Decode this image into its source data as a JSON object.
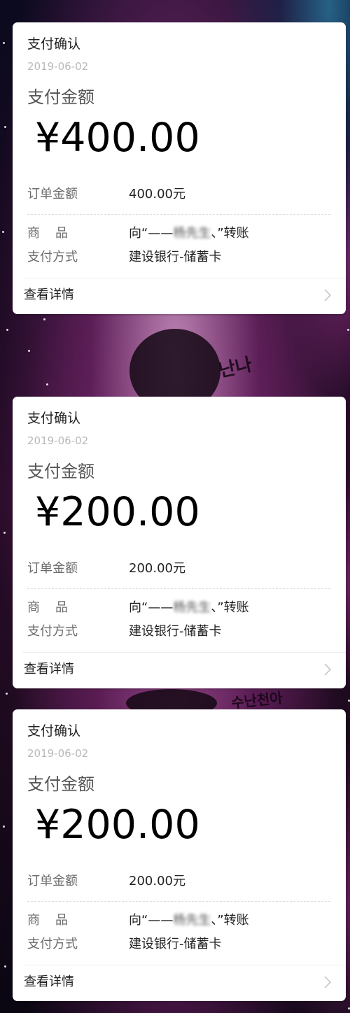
{
  "cards": [
    {
      "title": "支付确认",
      "date": "2019-06-02",
      "amount_label": "支付金额",
      "amount": "¥400.00",
      "order_label": "订单金额",
      "order_value": "400.00元",
      "goods_label": "商品",
      "goods_prefix": "向“——",
      "goods_name": "杨先生",
      "goods_suffix": "、”转账",
      "method_label": "支付方式",
      "method_value": "建设银行-储蓄卡",
      "details_label": "查看详情"
    },
    {
      "title": "支付确认",
      "date": "2019-06-02",
      "amount_label": "支付金额",
      "amount": "¥200.00",
      "order_label": "订单金额",
      "order_value": "200.00元",
      "goods_label": "商品",
      "goods_prefix": "向“——",
      "goods_name": "杨先生",
      "goods_suffix": "、”转账",
      "method_label": "支付方式",
      "method_value": "建设银行-储蓄卡",
      "details_label": "查看详情"
    },
    {
      "title": "支付确认",
      "date": "2019-06-02",
      "amount_label": "支付金额",
      "amount": "¥200.00",
      "order_label": "订单金额",
      "order_value": "200.00元",
      "goods_label": "商品",
      "goods_prefix": "向“——",
      "goods_name": "杨先生",
      "goods_suffix": "、”转账",
      "method_label": "支付方式",
      "method_value": "建设银行-储蓄卡",
      "details_label": "查看详情"
    }
  ],
  "background": {
    "scrawl_top": "난나",
    "scrawl_bottom": "수난천아"
  },
  "colors": {
    "card_bg": "#ffffff",
    "muted_text": "#b9b9b9",
    "label_text": "#6b6b6b",
    "primary_text": "#1f1f1f"
  },
  "icons": {
    "details_arrow": "chevron-right-icon"
  }
}
